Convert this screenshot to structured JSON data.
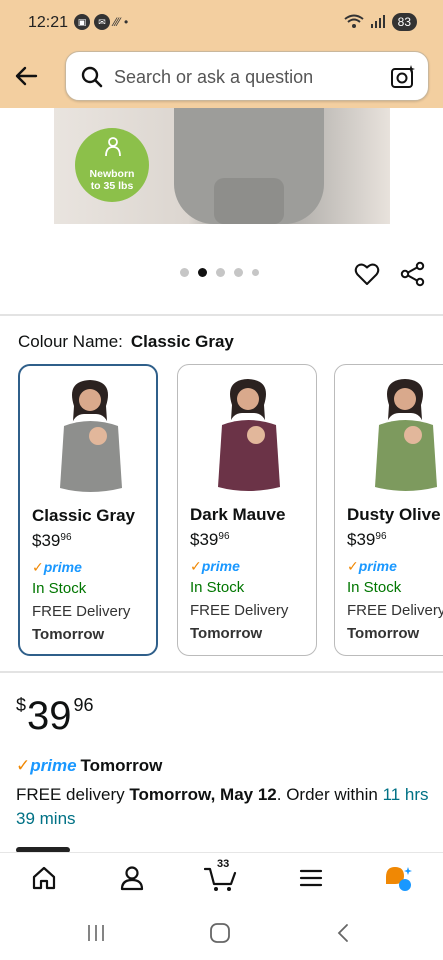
{
  "status_bar": {
    "time": "12:21",
    "battery": "83"
  },
  "header": {
    "search_placeholder": "Search or ask a question"
  },
  "hero": {
    "badge_line1": "Newborn",
    "badge_line2": "to 35 lbs"
  },
  "gallery": {
    "dot_count": 5,
    "active_index": 1
  },
  "colour": {
    "label": "Colour Name:",
    "selected": "Classic Gray"
  },
  "variants": [
    {
      "name": "Classic Gray",
      "currency": "$",
      "price_whole": "39",
      "price_fraction": "96",
      "prime": "prime",
      "stock": "In Stock",
      "delivery": "FREE Delivery",
      "when": "Tomorrow",
      "color": "#8e8f8d",
      "selected": true
    },
    {
      "name": "Dark Mauve",
      "currency": "$",
      "price_whole": "39",
      "price_fraction": "96",
      "prime": "prime",
      "stock": "In Stock",
      "delivery": "FREE Delivery",
      "when": "Tomorrow",
      "color": "#6b3347",
      "selected": false
    },
    {
      "name": "Dusty Olive",
      "currency": "$",
      "price_whole": "39",
      "price_fraction": "96",
      "prime": "prime",
      "stock": "In Stock",
      "delivery": "FREE Delivery",
      "when": "Tomorrow",
      "color": "#7d9a5e",
      "selected": false
    }
  ],
  "price": {
    "currency": "$",
    "whole": "39",
    "fraction": "96"
  },
  "prime_line": {
    "check": "✓",
    "label": "prime",
    "when": "Tomorrow"
  },
  "delivery": {
    "prefix": "FREE delivery ",
    "date": "Tomorrow, May 12",
    "middle": ". Order within ",
    "countdown": "11 hrs 39 mins"
  },
  "bottom_nav": {
    "cart_count": "33"
  },
  "colors": {
    "header_bg": "#f3cfa0",
    "prime_blue": "#1a98ff",
    "stock_green": "#007600",
    "selected_border": "#2f5f8a"
  }
}
